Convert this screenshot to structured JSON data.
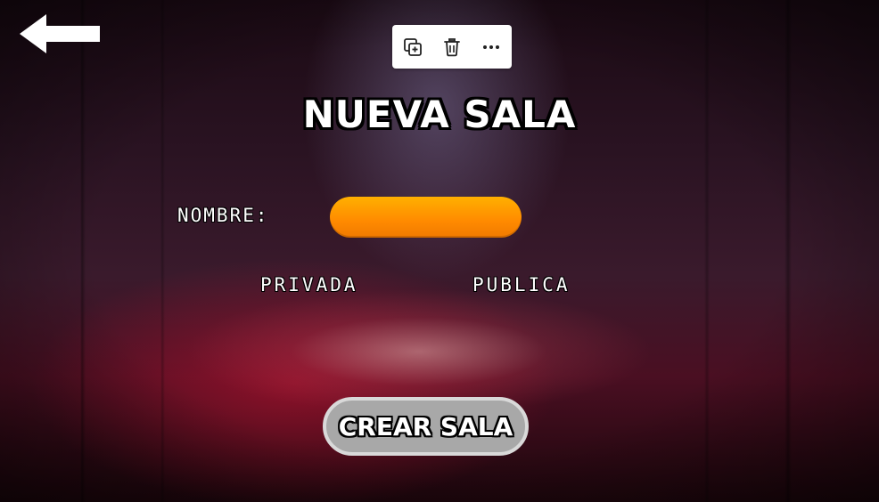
{
  "header": {
    "title": "NUEVA SALA"
  },
  "toolbar": {
    "actions": [
      {
        "icon": "duplicate-icon"
      },
      {
        "icon": "trash-icon"
      },
      {
        "icon": "more-horizontal-icon"
      }
    ]
  },
  "navigation": {
    "back_icon": "arrow-left-icon"
  },
  "form": {
    "name_label": "NOMBRE:",
    "name_value": "",
    "name_placeholder": "",
    "visibility_options": [
      {
        "label": "PRIVADA"
      },
      {
        "label": "PUBLICA"
      }
    ],
    "submit_label": "CREAR SALA"
  },
  "colors": {
    "input_fill": "#ff9a00",
    "button_fill": "#a8a8a8",
    "button_border": "#d9d9d9",
    "text": "#ffffff",
    "text_outline": "#000000"
  }
}
